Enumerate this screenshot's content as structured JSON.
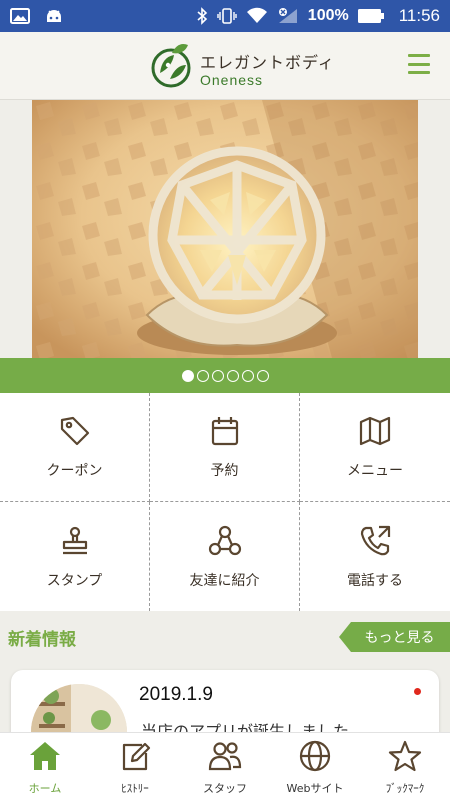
{
  "status_bar": {
    "battery_percent": "100%",
    "time": "11:56"
  },
  "header": {
    "logo_title": "エレガントボディ",
    "logo_subtitle": "Oneness",
    "menu_icon": "hamburger-icon"
  },
  "hero": {
    "slide_count": 6,
    "active_slide": 1
  },
  "grid": {
    "items": [
      {
        "label": "クーポン",
        "icon": "tag-icon"
      },
      {
        "label": "予約",
        "icon": "calendar-icon"
      },
      {
        "label": "メニュー",
        "icon": "map-icon"
      },
      {
        "label": "スタンプ",
        "icon": "stamp-icon"
      },
      {
        "label": "友達に紹介",
        "icon": "share-icon"
      },
      {
        "label": "電話する",
        "icon": "phone-icon"
      }
    ]
  },
  "news": {
    "title": "新着情報",
    "more_label": "もっと見る",
    "items": [
      {
        "date": "2019.1.9",
        "text": "当店のアプリが誕生しました。"
      }
    ]
  },
  "bottom_nav": {
    "items": [
      {
        "label": "ホーム",
        "icon": "home-icon",
        "active": true
      },
      {
        "label": "ﾋｽﾄﾘｰ",
        "icon": "edit-icon",
        "active": false
      },
      {
        "label": "スタッフ",
        "icon": "staff-icon",
        "active": false
      },
      {
        "label": "Webサイト",
        "icon": "globe-icon",
        "active": false
      },
      {
        "label": "ﾌﾞｯｸﾏｰｸ",
        "icon": "star-icon",
        "active": false
      }
    ]
  },
  "colors": {
    "accent": "#76ac48",
    "status_bar": "#2f56a8",
    "icon_stroke": "#5a4630",
    "notification_dot": "#e0281d"
  }
}
